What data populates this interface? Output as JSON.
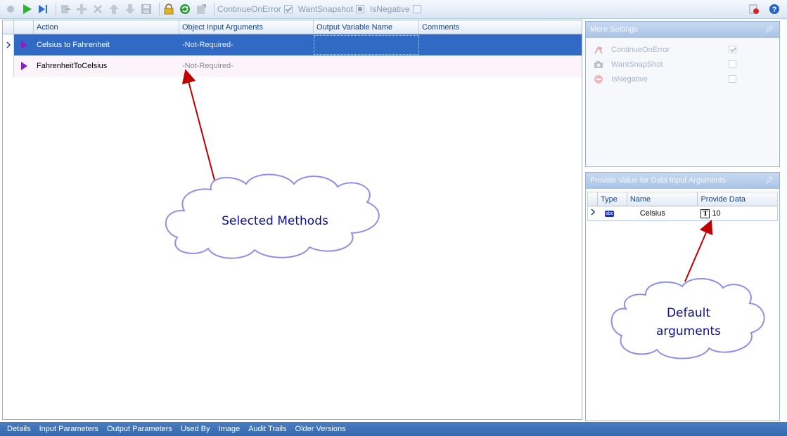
{
  "toolbar": {
    "continue_on_error": "ContinueOnError",
    "want_snapshot": "WantSnapshot",
    "is_negative": "IsNegative"
  },
  "grid": {
    "columns": [
      "Action",
      "Object Input Arguments",
      "Output Variable Name",
      "Comments"
    ],
    "rows": [
      {
        "action": "Celsius to Fahrenheit",
        "object_input": "-Not-Required-",
        "output_variable": "",
        "comments": ""
      },
      {
        "action": "FahrenheitToCelsius",
        "object_input": "-Not-Required-",
        "output_variable": "",
        "comments": ""
      }
    ]
  },
  "more_settings": {
    "title": "More Settings",
    "items": [
      {
        "label": "ContinueOnError",
        "checked": true
      },
      {
        "label": "WantSnapShot",
        "checked": false
      },
      {
        "label": "IsNegative",
        "checked": false
      }
    ]
  },
  "data_input": {
    "title": "Provide Value for Data Input Arguments",
    "columns": [
      "Type",
      "Name",
      "Provide Data"
    ],
    "rows": [
      {
        "type_icon": "abc",
        "name": "Celsius",
        "value": "10"
      }
    ]
  },
  "bottom_tabs": [
    "Details",
    "Input Parameters",
    "Output Parameters",
    "Used By",
    "Image",
    "Audit Trails",
    "Older Versions"
  ],
  "annotations": {
    "selected_methods": "Selected Methods",
    "default_arguments_line1": "Default",
    "default_arguments_line2": "arguments"
  },
  "colors": {
    "selection": "#316ac5",
    "annotation_arrow": "#c00000",
    "cloud_fill": "#ffffff",
    "cloud_stroke": "#8f8fe8"
  }
}
